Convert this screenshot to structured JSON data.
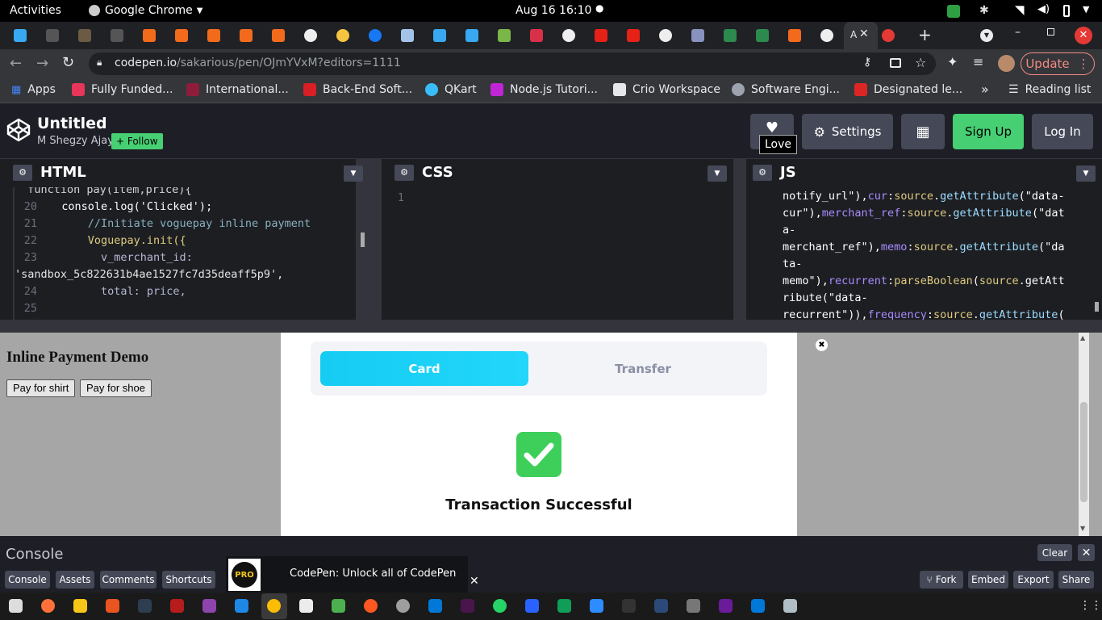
{
  "system_bar": {
    "activities": "Activities",
    "app_name": "Google Chrome",
    "clock": "Aug 16  16:10"
  },
  "browser": {
    "active_tab_title": "A",
    "url_host": "codepen.io",
    "url_path": "/sakarious/pen/OJmYVxM?editors=1111",
    "update_button": "Update",
    "bookmarks": [
      {
        "label": "Apps",
        "color": "#4285f4"
      },
      {
        "label": "Fully Funded...",
        "color": "#e8355b"
      },
      {
        "label": "International...",
        "color": "#8e1d3b"
      },
      {
        "label": "Back-End Soft...",
        "color": "#d91f26"
      },
      {
        "label": "QKart",
        "color": "#38bdf8"
      },
      {
        "label": "Node.js Tutori...",
        "color": "#c026d3"
      },
      {
        "label": "Crio Workspace",
        "color": "#e5e7eb"
      },
      {
        "label": "Software Engi...",
        "color": "#9ca3af"
      },
      {
        "label": "Designated le...",
        "color": "#dc2626"
      }
    ],
    "reading_list": "Reading list"
  },
  "codepen": {
    "pen_title": "Untitled",
    "author": "M Shegzy Ajay",
    "follow_button": "+ Follow",
    "love_tooltip": "Love",
    "settings_button": "Settings",
    "signup_button": "Sign Up",
    "login_button": "Log In",
    "accent": "#47cf73",
    "editors": {
      "html": {
        "title": "HTML",
        "lines": [
          {
            "n": "20",
            "code": "  console.log('Clicked');"
          },
          {
            "n": "21",
            "code": "      //Initiate voguepay inline payment"
          },
          {
            "n": "22",
            "code": "      Voguepay.init({"
          },
          {
            "n": "23",
            "code": "        v_merchant_id:"
          },
          {
            "n": "",
            "code": "'sandbox_5c822631b4ae1527fc7d35deaff5p9',"
          },
          {
            "n": "24",
            "code": "        total: price,"
          },
          {
            "n": "25",
            "code": ""
          }
        ]
      },
      "css": {
        "title": "CSS",
        "line_no": "1"
      },
      "js": {
        "title": "JS",
        "lines": [
          "notify_url\"),cur:source.getAttribute(\"data-",
          "cur\"),merchant_ref:source.getAttribute(\"dat",
          "a-",
          "merchant_ref\"),memo:source.getAttribute(\"da",
          "ta-",
          "memo\"),recurrent:parseBoolean(source.getAtt",
          "ribute(\"data-",
          "recurrent\")),frequency:source.getAttribute("
        ]
      }
    },
    "result": {
      "demo_heading": "Inline Payment Demo",
      "shirt_button": "Pay for shirt",
      "shoe_button": "Pay for shoe",
      "modal": {
        "tab_card": "Card",
        "tab_transfer": "Transfer",
        "status": "Transaction Successful",
        "success_color": "#3ecf5a"
      }
    },
    "console": {
      "title": "Console",
      "clear_button": "Clear",
      "bottom_tabs": [
        "Console",
        "Assets",
        "Comments",
        "Shortcuts"
      ],
      "promo_badge": "PRO",
      "promo_text": "CodePen: Unlock all of CodePen",
      "actions": [
        "Fork",
        "Embed",
        "Export",
        "Share"
      ]
    }
  }
}
